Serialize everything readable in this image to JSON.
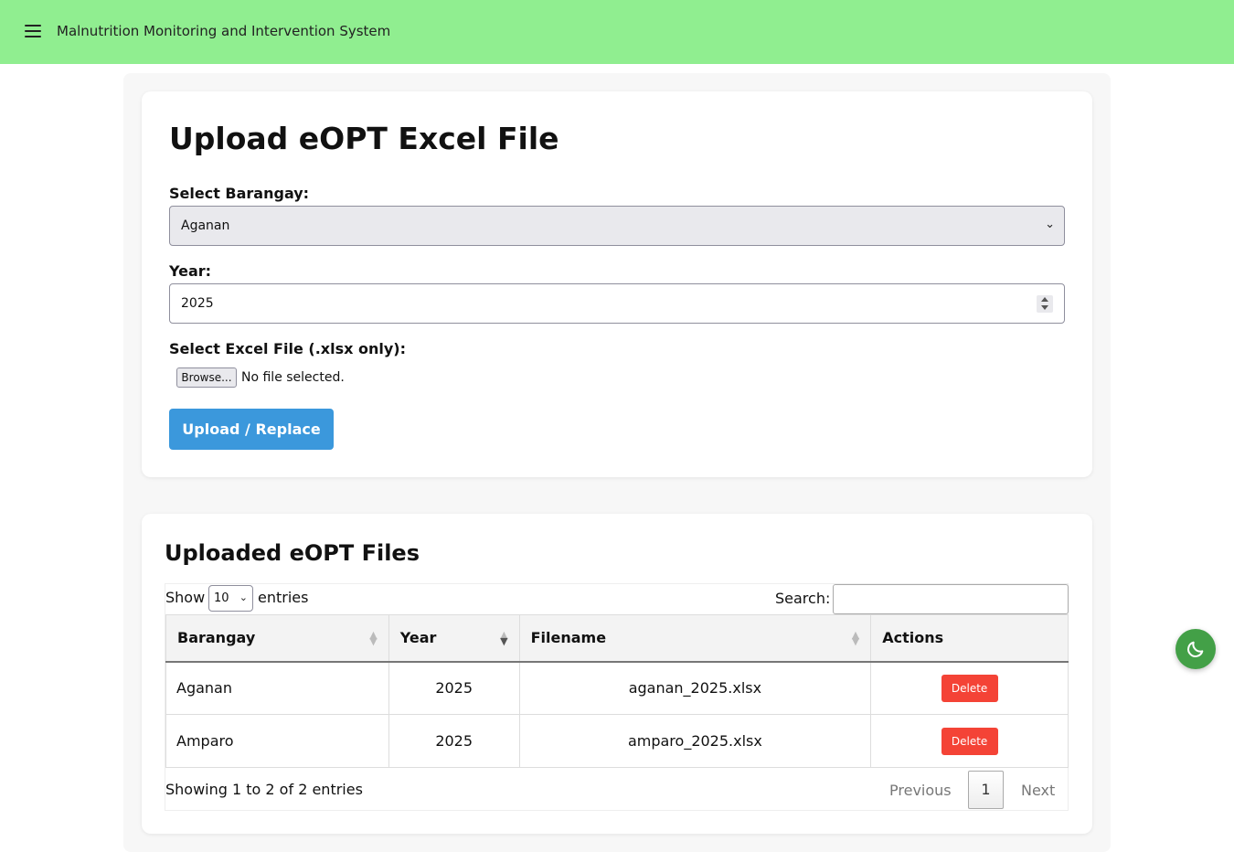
{
  "header": {
    "title": "Malnutrition Monitoring and Intervention System",
    "menu_icon": "hamburger-menu-icon"
  },
  "upload_form": {
    "heading": "Upload eOPT Excel File",
    "barangay_label": "Select Barangay:",
    "barangay_selected": "Aganan",
    "year_label": "Year:",
    "year_value": "2025",
    "file_label": "Select Excel File (.xlsx only):",
    "browse_label": "Browse...",
    "file_status": "No file selected.",
    "submit_label": "Upload / Replace"
  },
  "files": {
    "heading": "Uploaded eOPT Files",
    "show_label": "Show",
    "page_length": "10",
    "entries_label": "entries",
    "search_label": "Search:",
    "search_value": "",
    "columns": [
      "Barangay",
      "Year",
      "Filename",
      "Actions"
    ],
    "rows": [
      {
        "barangay": "Aganan",
        "year": "2025",
        "filename": "aganan_2025.xlsx",
        "action": "Delete"
      },
      {
        "barangay": "Amparo",
        "year": "2025",
        "filename": "amparo_2025.xlsx",
        "action": "Delete"
      }
    ],
    "info": "Showing 1 to 2 of 2 entries",
    "pagination": {
      "previous": "Previous",
      "current": "1",
      "next": "Next"
    }
  },
  "theme_toggle": {
    "icon": "moon-icon"
  },
  "colors": {
    "header_bg": "#90ee90",
    "primary_button": "#3b98dc",
    "delete_button": "#f44336",
    "theme_button": "#43a047"
  }
}
